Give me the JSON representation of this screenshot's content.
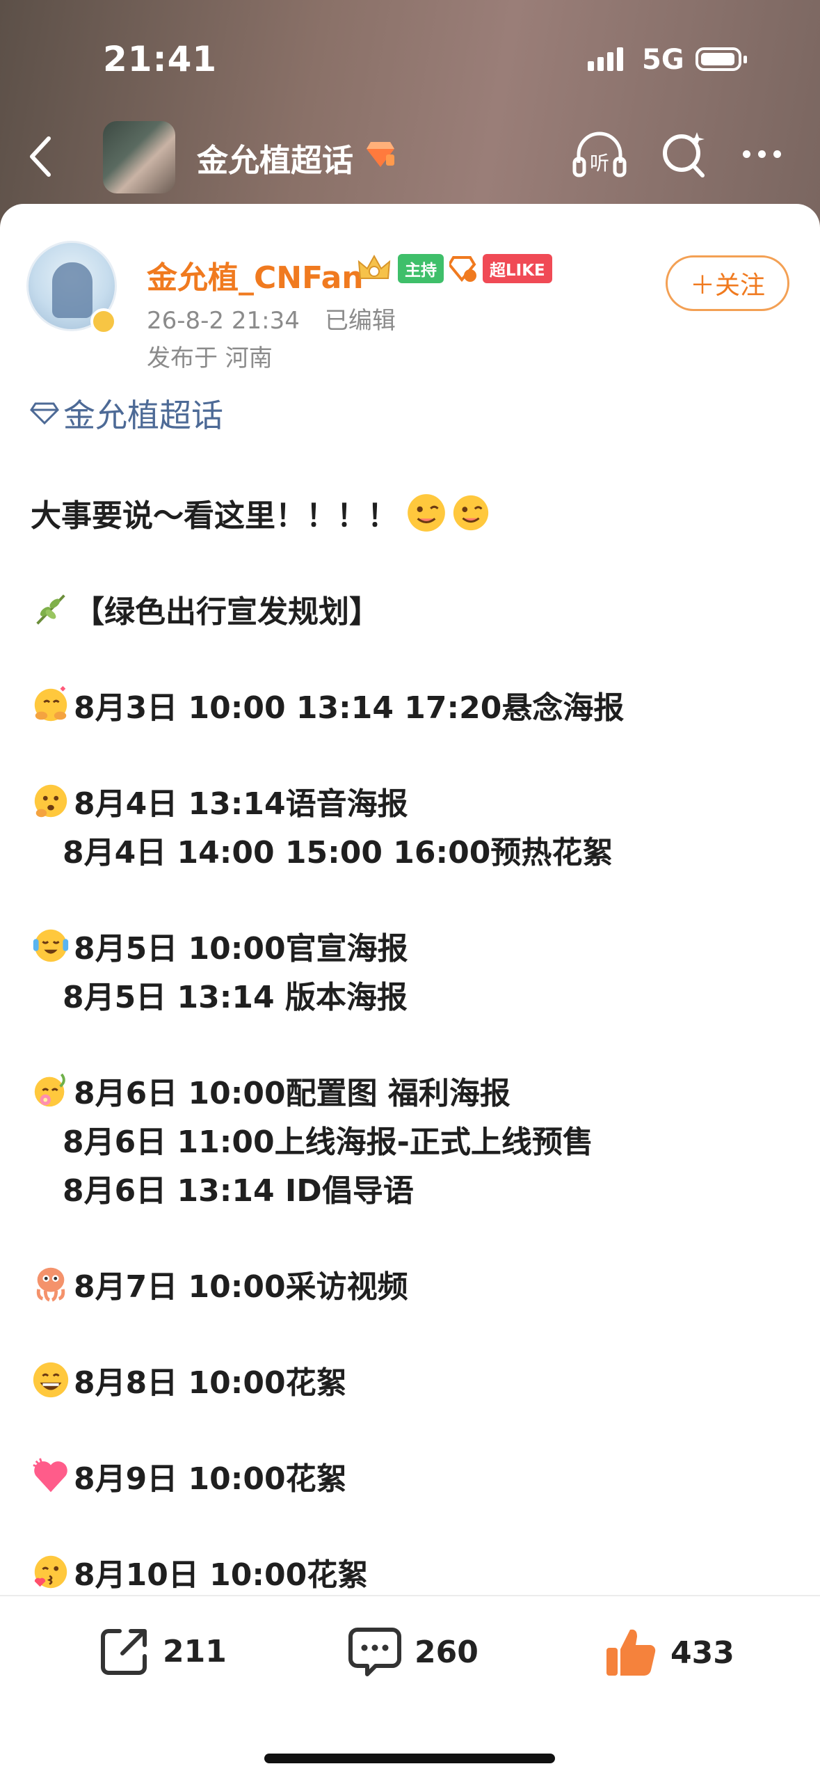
{
  "status_bar": {
    "time": "21:41",
    "network": "5G"
  },
  "nav": {
    "title": "金允植超话"
  },
  "author": {
    "name": "金允植_CNFan",
    "badge_host": "主持",
    "badge_like": "超LIKE",
    "date": "26-8-2 21:34",
    "edited": "已编辑",
    "location": "发布于 河南",
    "follow_label": "＋关注"
  },
  "post": {
    "topic": "金允植超话",
    "headline": "大事要说～看这里！！！！",
    "section_title": "【绿色出行宣发规划】",
    "schedule": [
      "8月3日 10:00 13:14 17:20悬念海报",
      "8月4日 13:14语音海报",
      "8月4日 14:00 15:00 16:00预热花絮",
      "8月5日 10:00官宣海报",
      "8月5日 13:14 版本海报",
      "8月6日 10:00配置图 福利海报",
      "8月6日 11:00上线海报-正式上线预售",
      "8月6日 13:14 ID倡导语",
      "8月7日 10:00采访视频",
      "8月8日 10:00花絮",
      "8月9日 10:00花絮",
      "8月10日 10:00花絮"
    ]
  },
  "actions": {
    "share_count": "211",
    "comment_count": "260",
    "like_count": "433"
  },
  "colors": {
    "accent_orange": "#f07a1f",
    "topic_blue": "#4d6a96",
    "host_green": "#3fbf6a",
    "like_red": "#f04a55"
  }
}
